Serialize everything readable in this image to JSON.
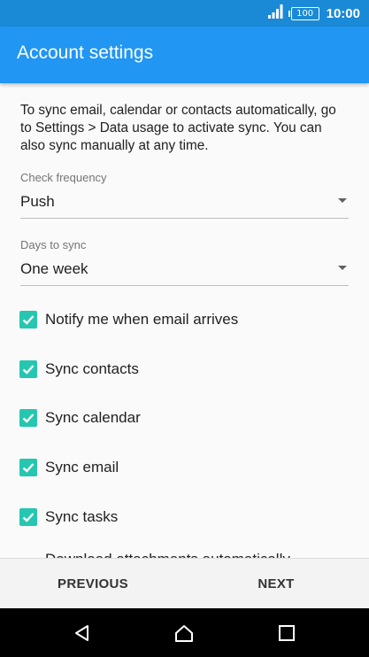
{
  "status_bar": {
    "battery": "100",
    "time": "10:00"
  },
  "app_bar": {
    "title": "Account settings"
  },
  "intro": "To sync email, calendar or contacts automatically, go to Settings > Data usage to activate sync. You can also sync manually at any time.",
  "check_frequency": {
    "label": "Check frequency",
    "value": "Push"
  },
  "days_to_sync": {
    "label": "Days to sync",
    "value": "One week"
  },
  "options": [
    {
      "label": "Notify me when email arrives",
      "checked": true
    },
    {
      "label": "Sync contacts",
      "checked": true
    },
    {
      "label": "Sync calendar",
      "checked": true
    },
    {
      "label": "Sync email",
      "checked": true
    },
    {
      "label": "Sync tasks",
      "checked": true
    }
  ],
  "cutoff_text": "Download attachments automatically",
  "buttons": {
    "previous": "PREVIOUS",
    "next": "NEXT"
  },
  "colors": {
    "status_bar": "#1a8ad6",
    "app_bar": "#2196f3",
    "checkbox": "#26c6b0"
  }
}
